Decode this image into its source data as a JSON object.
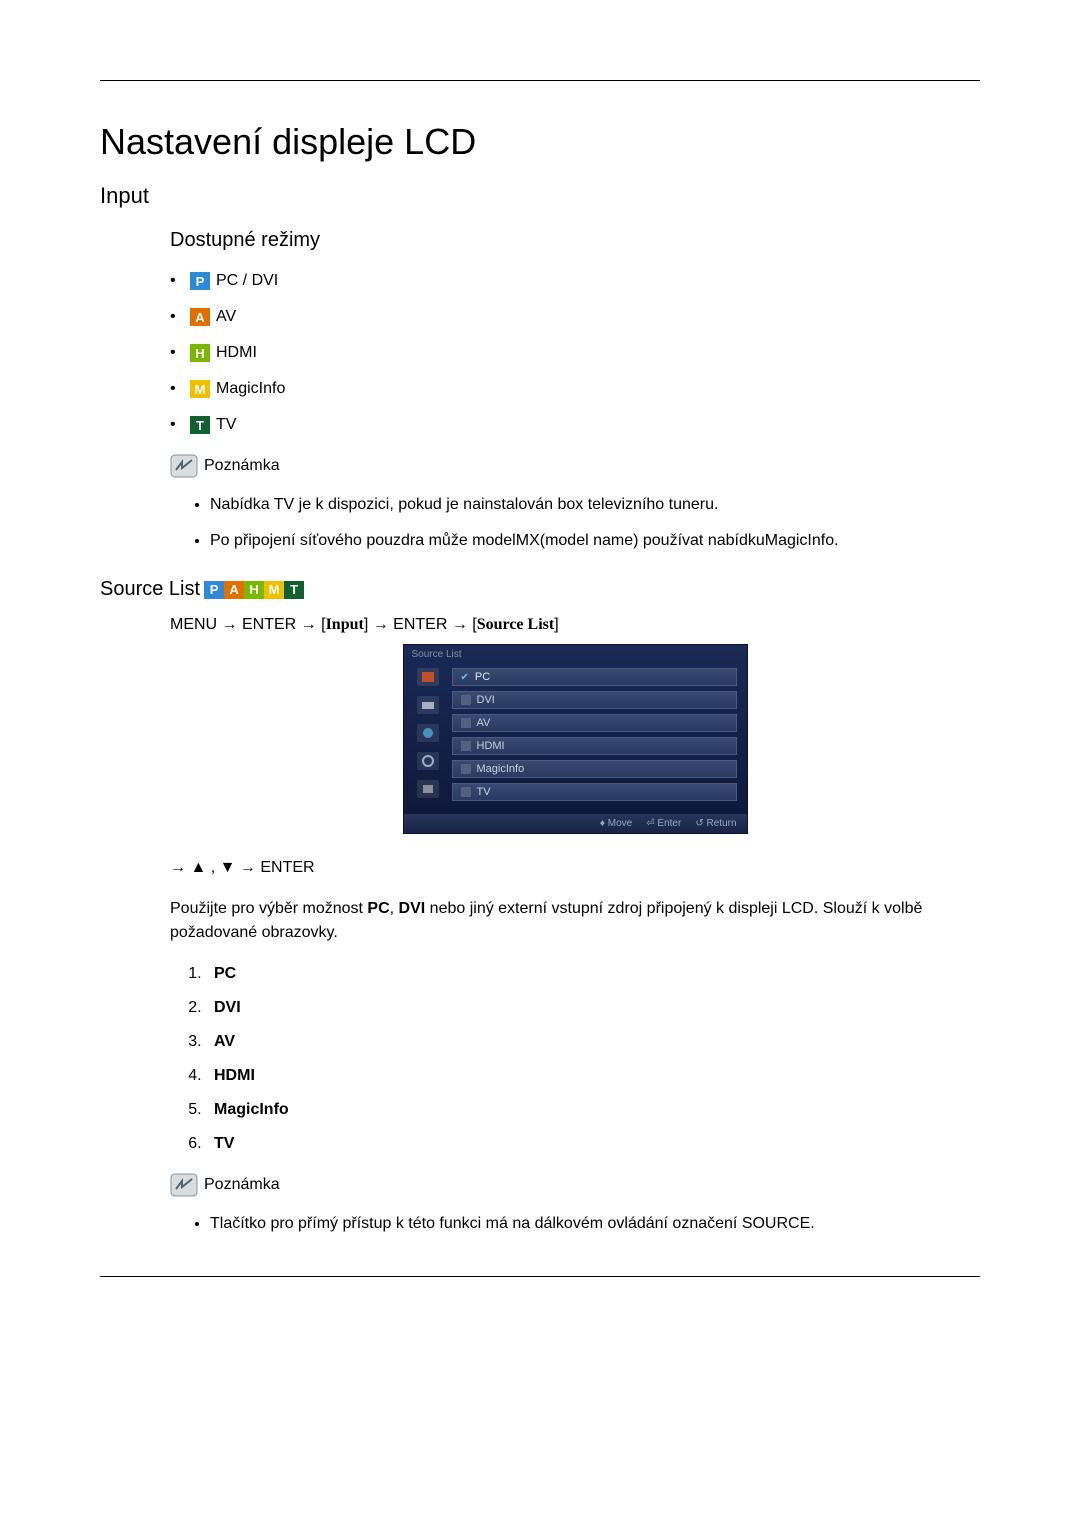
{
  "title": "Nastavení displeje LCD",
  "section_input": "Input",
  "subsection_modes": "Dostupné režimy",
  "modes": [
    {
      "icon": "P",
      "cls": "icon-p",
      "label": "PC / DVI"
    },
    {
      "icon": "A",
      "cls": "icon-a",
      "label": "AV"
    },
    {
      "icon": "H",
      "cls": "icon-h",
      "label": "HDMI"
    },
    {
      "icon": "M",
      "cls": "icon-m",
      "label": "MagicInfo"
    },
    {
      "icon": "T",
      "cls": "icon-t",
      "label": "TV"
    }
  ],
  "note_label": "Poznámka",
  "notes1": [
    "Nabídka TV je k dispozici, pokud je nainstalován box televizního tuneru.",
    "Po připojení síťového pouzdra může modelMX(model name) používat nabídkuMagicInfo."
  ],
  "source_list_title": "Source List",
  "menu_path": {
    "pre": "MENU → ENTER → [",
    "inp": "Input",
    "mid": "] → ENTER → [",
    "src": "Source List",
    "post": "]"
  },
  "osd": {
    "header": "Source List",
    "items": [
      "PC",
      "DVI",
      "AV",
      "HDMI",
      "MagicInfo",
      "TV"
    ],
    "footer": {
      "move": "Move",
      "enter": "Enter",
      "return": "Return"
    }
  },
  "nav_hint": "→ ▲ , ▼ → ENTER",
  "description": {
    "p1a": "Použijte pro výběr možnost ",
    "pc": "PC",
    "p1b": ", ",
    "dvi": "DVI",
    "p1c": " nebo jiný externí vstupní zdroj připojený k displeji LCD. Slouží k volbě požadované obrazovky."
  },
  "numbered": [
    "PC",
    "DVI",
    "AV",
    "HDMI",
    "MagicInfo",
    "TV"
  ],
  "notes2": [
    "Tlačítko pro přímý přístup k této funkci má na dálkovém ovládání označení SOURCE."
  ]
}
